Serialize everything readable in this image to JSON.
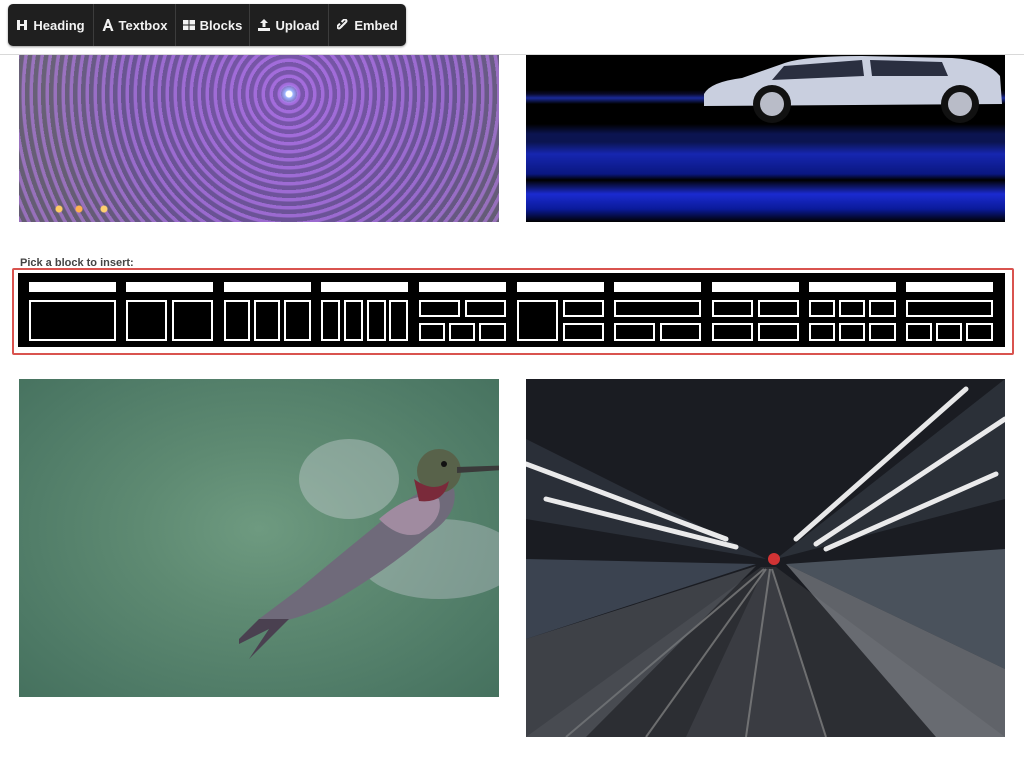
{
  "toolbar": {
    "buttons": [
      {
        "label": "Heading",
        "icon": "heading-icon"
      },
      {
        "label": "Textbox",
        "icon": "font-icon"
      },
      {
        "label": "Blocks",
        "icon": "grid-icon"
      },
      {
        "label": "Upload",
        "icon": "upload-icon"
      },
      {
        "label": "Embed",
        "icon": "link-icon"
      }
    ],
    "background": "#1f1f1f"
  },
  "picker": {
    "label": "Pick a block to insert:",
    "highlight_color": "#d9534f",
    "options": [
      {
        "name": "one-column"
      },
      {
        "name": "two-columns"
      },
      {
        "name": "three-columns"
      },
      {
        "name": "four-columns"
      },
      {
        "name": "two-over-three"
      },
      {
        "name": "one-left-two-right"
      },
      {
        "name": "one-over-two"
      },
      {
        "name": "two-over-two"
      },
      {
        "name": "three-over-three"
      },
      {
        "name": "one-over-three"
      }
    ]
  },
  "images": [
    {
      "name": "ferris-wheel-long-exposure-photo"
    },
    {
      "name": "blue-car-motion-photo"
    },
    {
      "name": "hummingbird-photo"
    },
    {
      "name": "train-station-motion-photo"
    }
  ]
}
